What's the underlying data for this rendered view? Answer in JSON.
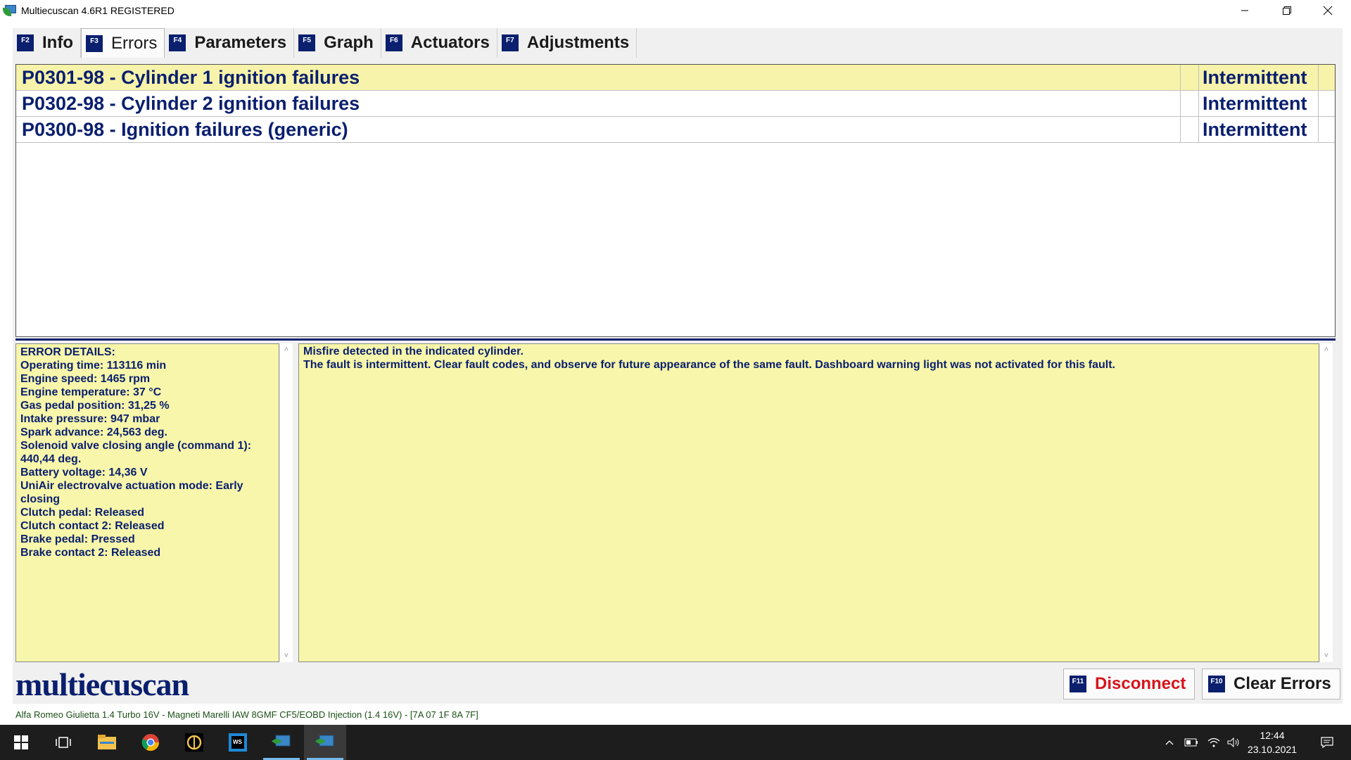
{
  "window": {
    "title": "Multiecuscan 4.6R1 REGISTERED",
    "minimize_icon": "minimize-icon",
    "maximize_icon": "restore-icon",
    "close_icon": "close-icon"
  },
  "tabs": [
    {
      "key": "F2",
      "label": "Info",
      "active": false
    },
    {
      "key": "F3",
      "label": "Errors",
      "active": true
    },
    {
      "key": "F4",
      "label": "Parameters",
      "active": false
    },
    {
      "key": "F5",
      "label": "Graph",
      "active": false
    },
    {
      "key": "F6",
      "label": "Actuators",
      "active": false
    },
    {
      "key": "F7",
      "label": "Adjustments",
      "active": false
    }
  ],
  "errors": [
    {
      "code": "P0301-98 - Cylinder 1 ignition failures",
      "status": "Intermittent",
      "selected": true
    },
    {
      "code": "P0302-98 - Cylinder 2 ignition failures",
      "status": "Intermittent",
      "selected": false
    },
    {
      "code": "P0300-98 - Ignition failures (generic)",
      "status": "Intermittent",
      "selected": false
    }
  ],
  "details": {
    "lines": [
      "ERROR DETAILS:",
      "Operating time: 113116 min",
      "Engine speed: 1465 rpm",
      "Engine temperature: 37 °C",
      "Gas pedal position: 31,25 %",
      "Intake pressure: 947 mbar",
      "Spark advance: 24,563 deg.",
      "Solenoid valve closing angle (command 1):",
      "440,44 deg.",
      "Battery voltage: 14,36 V",
      "UniAir electrovalve actuation mode: Early",
      "closing",
      "Clutch pedal: Released",
      "Clutch contact 2: Released",
      "Brake pedal: Pressed",
      "Brake contact 2: Released"
    ]
  },
  "description": {
    "lines": [
      "Misfire detected in the indicated cylinder.",
      "The fault is intermittent. Clear fault codes, and observe for future appearance of the same fault. Dashboard warning light was not activated for this fault."
    ]
  },
  "brand": "multiecuscan",
  "buttons": {
    "disconnect": {
      "key": "F11",
      "label": "Disconnect",
      "color": "#d8141c"
    },
    "clear_errors": {
      "key": "F10",
      "label": "Clear Errors",
      "color": "#1a1a1a"
    }
  },
  "status_bar": "Alfa Romeo Giulietta 1.4 Turbo 16V - Magneti Marelli IAW 8GMF CF5/EOBD Injection (1.4 16V) - [7A 07 1F 8A 7F]",
  "taskbar": {
    "apps": [
      "windows-start-icon",
      "task-view-icon",
      "file-explorer-icon",
      "chrome-icon",
      "app-icon",
      "webstorm-icon",
      "multiecuscan-icon",
      "multiecuscan-icon"
    ],
    "time": "12:44",
    "date": "23.10.2021",
    "tray": [
      "chevron-up-icon",
      "battery-icon",
      "wifi-icon",
      "volume-icon",
      "notification-icon"
    ]
  },
  "colors": {
    "accent_navy": "#0a1f6e",
    "selection_yellow": "#f7f3aa",
    "panel_yellow": "#f7f6aa",
    "disconnect_red": "#d8141c"
  }
}
